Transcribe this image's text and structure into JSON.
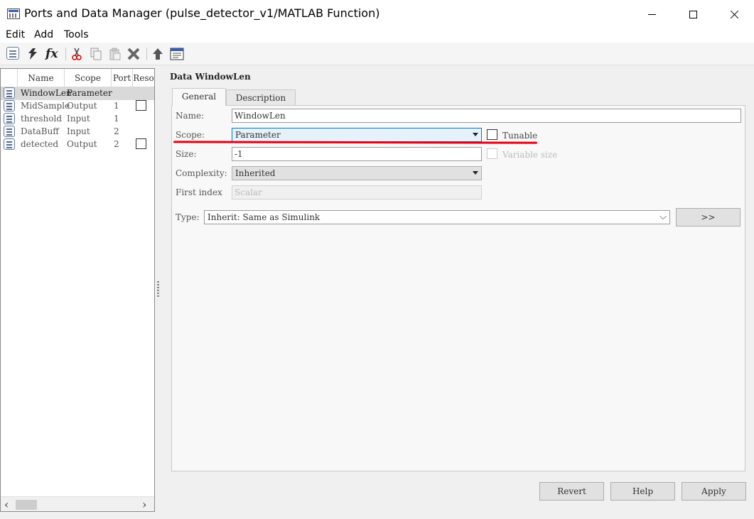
{
  "window": {
    "title": "Ports and Data Manager (pulse_detector_v1/MATLAB Function)"
  },
  "menu": {
    "items": [
      "Edit",
      "Add",
      "Tools"
    ]
  },
  "toolbar": {
    "icons": [
      "add-data-icon",
      "add-event-icon",
      "add-function-icon",
      "cut-icon",
      "copy-icon",
      "paste-icon",
      "delete-icon",
      "move-up-icon",
      "model-explorer-icon"
    ]
  },
  "grid": {
    "columns": [
      "Name",
      "Scope",
      "Port",
      "Reso"
    ],
    "rows": [
      {
        "name": "WindowLen",
        "scope": "Parameter",
        "port": "",
        "reso": null
      },
      {
        "name": "MidSample",
        "scope": "Output",
        "port": "1",
        "reso": false
      },
      {
        "name": "threshold",
        "scope": "Input",
        "port": "1",
        "reso": null
      },
      {
        "name": "DataBuff",
        "scope": "Input",
        "port": "2",
        "reso": null
      },
      {
        "name": "detected",
        "scope": "Output",
        "port": "2",
        "reso": false
      }
    ]
  },
  "details": {
    "title": "Data WindowLen",
    "tabs": [
      "General",
      "Description"
    ],
    "active_tab": "General",
    "name_label": "Name:",
    "name_value": "WindowLen",
    "scope_label": "Scope:",
    "scope_value": "Parameter",
    "tunable_label": "Tunable",
    "tunable_checked": false,
    "size_label": "Size:",
    "size_value": "-1",
    "variable_size_label": "Variable size",
    "variable_size_checked": false,
    "complexity_label": "Complexity:",
    "complexity_value": "Inherited",
    "first_index_label": "First index",
    "first_index_placeholder": "Scalar",
    "type_label": "Type:",
    "type_value": "Inherit: Same as Simulink",
    "type_assistant_label": ">>"
  },
  "buttons": {
    "revert": "Revert",
    "help": "Help",
    "apply": "Apply"
  },
  "colors": {
    "annotation_underline": "#e60012",
    "focus_border": "#0078d7"
  }
}
